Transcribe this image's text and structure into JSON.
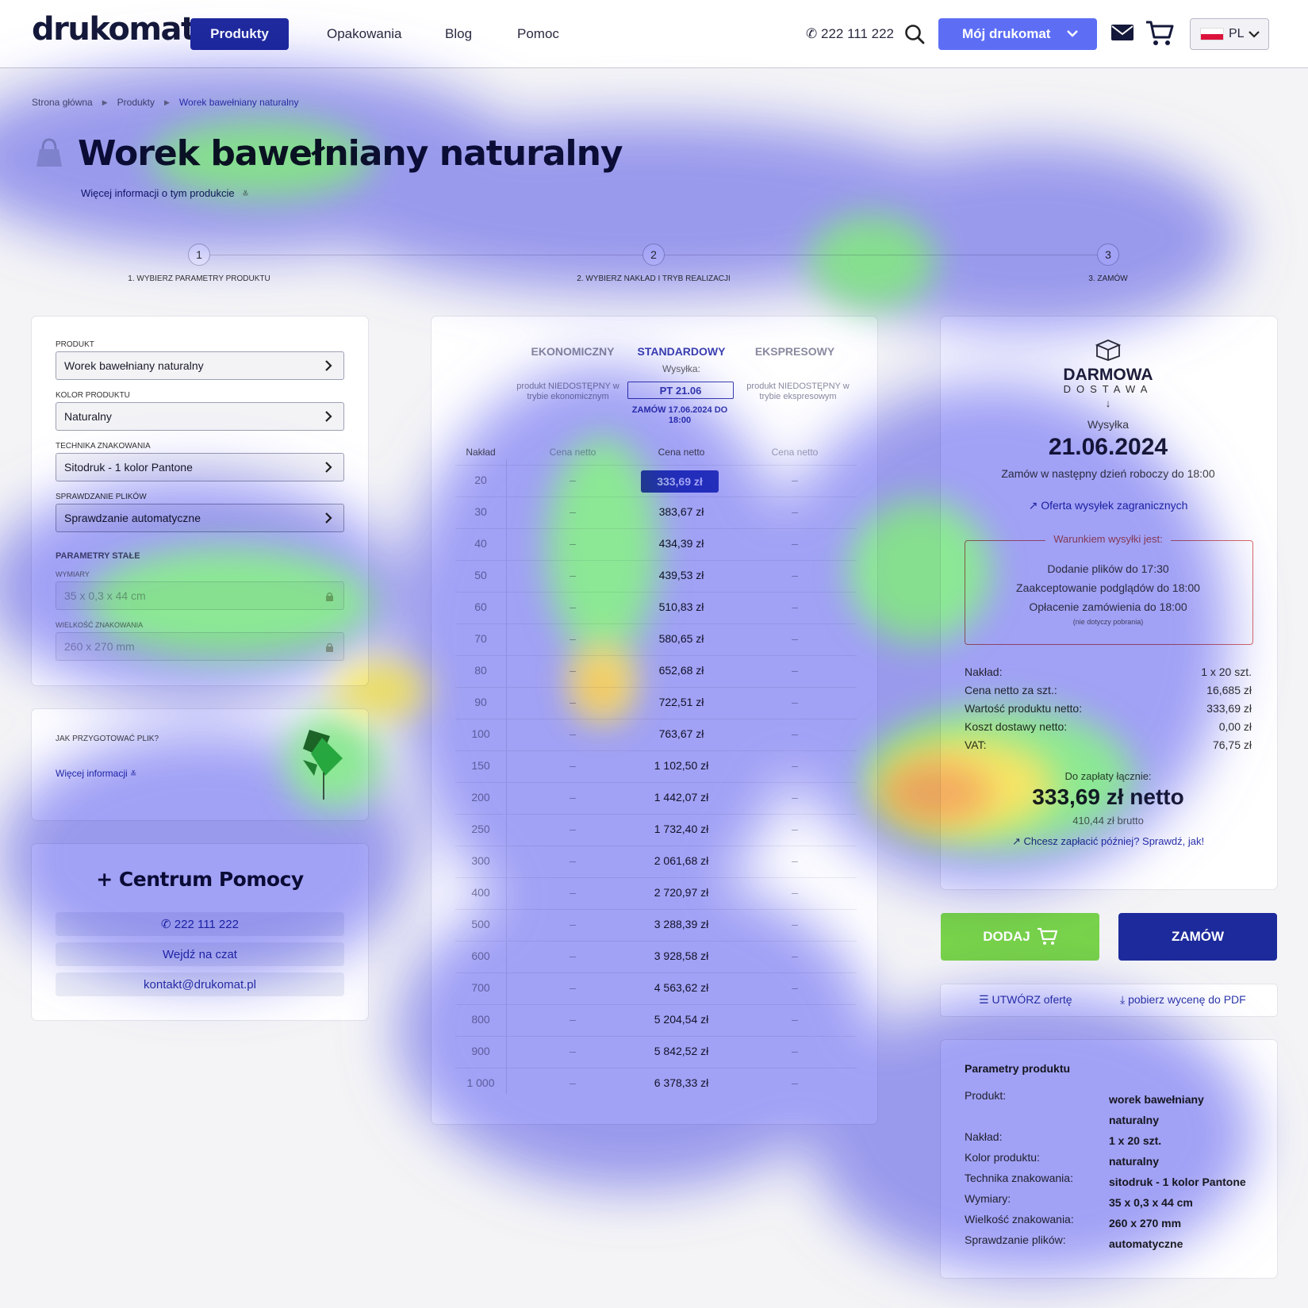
{
  "header": {
    "logo": "drukomat.",
    "nav": {
      "produkty": "Produkty",
      "opakowania": "Opakowania",
      "blog": "Blog",
      "pomoc": "Pomoc"
    },
    "phone": "222 111 222",
    "account_label": "Mój drukomat",
    "lang": "PL"
  },
  "breadcrumb": [
    "Strona główna",
    "Produkty",
    "Worek bawełniany naturalny"
  ],
  "title": "Worek bawełniany naturalny",
  "more_info": "Więcej informacji o tym produkcie",
  "steps": [
    "1. WYBIERZ PARAMETRY PRODUKTU",
    "2. WYBIERZ NAKŁAD I TRYB REALIZACJI",
    "3. ZAMÓW"
  ],
  "step_numbers": [
    "1",
    "2",
    "3"
  ],
  "config": {
    "product_label": "PRODUKT",
    "product_value": "Worek bawełniany naturalny",
    "color_label": "KOLOR PRODUKTU",
    "color_value": "Naturalny",
    "technique_label": "TECHNIKA ZNAKOWANIA",
    "technique_value": "Sitodruk - 1 kolor Pantone",
    "files_label": "SPRAWDZANIE PLIKÓW",
    "files_value": "Sprawdzanie automatyczne",
    "fixed_label": "PARAMETRY STAŁE",
    "dims_label": "WYMIARY",
    "dims_value": "35 x 0,3 x 44 cm",
    "mark_size_label": "WIELKOŚĆ ZNAKOWANIA",
    "mark_size_value": "260 x 270 mm"
  },
  "prep": {
    "question": "JAK PRZYGOTOWAĆ PLIK?",
    "link": "Więcej informacji"
  },
  "help": {
    "title": "+ Centrum Pomocy",
    "phone": "222 111 222",
    "chat": "Wejdź na czat",
    "email": "kontakt@drukomat.pl"
  },
  "pricing": {
    "modes": {
      "eco": "EKONOMICZNY",
      "std": "STANDARDOWY",
      "exp": "EKSPRESOWY"
    },
    "shipping_label": "Wysyłka:",
    "eco_na": "produkt NIEDOSTĘPNY w trybie ekonomicznym",
    "exp_na": "produkt NIEDOSTĘPNY w trybie ekspresowym",
    "ship_date": "PT 21.06",
    "order_by": "ZAMÓW 17.06.2024 DO 18:00",
    "col_qty": "Nakład",
    "col_price": "Cena netto",
    "dash": "–",
    "rows": [
      {
        "q": "20",
        "p": "333,69 zł"
      },
      {
        "q": "30",
        "p": "383,67 zł"
      },
      {
        "q": "40",
        "p": "434,39 zł"
      },
      {
        "q": "50",
        "p": "439,53 zł"
      },
      {
        "q": "60",
        "p": "510,83 zł"
      },
      {
        "q": "70",
        "p": "580,65 zł"
      },
      {
        "q": "80",
        "p": "652,68 zł"
      },
      {
        "q": "90",
        "p": "722,51 zł"
      },
      {
        "q": "100",
        "p": "763,67 zł"
      },
      {
        "q": "150",
        "p": "1 102,50 zł"
      },
      {
        "q": "200",
        "p": "1 442,07 zł"
      },
      {
        "q": "250",
        "p": "1 732,40 zł"
      },
      {
        "q": "300",
        "p": "2 061,68 zł"
      },
      {
        "q": "400",
        "p": "2 720,97 zł"
      },
      {
        "q": "500",
        "p": "3 288,39 zł"
      },
      {
        "q": "600",
        "p": "3 928,58 zł"
      },
      {
        "q": "700",
        "p": "4 563,62 zł"
      },
      {
        "q": "800",
        "p": "5 204,54 zł"
      },
      {
        "q": "900",
        "p": "5 842,52 zł"
      },
      {
        "q": "1 000",
        "p": "6 378,33 zł"
      }
    ]
  },
  "summary": {
    "free_delivery": "DARMOWA",
    "delivery": "DOSTAWA",
    "ship_label": "Wysyłka",
    "ship_date": "21.06.2024",
    "order_note": "Zamów w następny dzień roboczy do 18:00",
    "intl_link": "Oferta wysyłek zagranicznych",
    "condition_title": "Warunkiem wysyłki jest:",
    "cond1": "Dodanie plików do 17:30",
    "cond2": "Zaakceptowanie podglądów do 18:00",
    "cond3": "Opłacenie zamówienia do 18:00",
    "cond_note": "(nie dotyczy pobrania)",
    "rows": [
      {
        "k": "Nakład:",
        "v": "1 x 20 szt."
      },
      {
        "k": "Cena netto za szt.:",
        "v": "16,685 zł"
      },
      {
        "k": "Wartość produktu netto:",
        "v": "333,69 zł"
      },
      {
        "k": "Koszt dostawy netto:",
        "v": "0,00 zł"
      },
      {
        "k": "VAT:",
        "v": "76,75 zł"
      }
    ],
    "total_label": "Do zapłaty łącznie:",
    "total_net": "333,69 zł netto",
    "total_gross": "410,44 zł brutto",
    "pay_later": "Chcesz zapłacić później? Sprawdź, jak!"
  },
  "actions": {
    "add": "DODAJ",
    "order": "ZAMÓW",
    "create_offer": "UTWÓRZ ofertę",
    "pdf": "pobierz wycenę do PDF"
  },
  "params": {
    "title": "Parametry produktu",
    "rows": [
      {
        "k": "Produkt:",
        "v": "worek bawełniany naturalny"
      },
      {
        "k": "Nakład:",
        "v": "1 x 20 szt."
      },
      {
        "k": "Kolor produktu:",
        "v": "naturalny"
      },
      {
        "k": "Technika znakowania:",
        "v": "sitodruk - 1 kolor Pantone"
      },
      {
        "k": "Wymiary:",
        "v": "35 x 0,3 x 44 cm"
      },
      {
        "k": "Wielkość znakowania:",
        "v": "260 x 270 mm"
      },
      {
        "k": "Sprawdzanie plików:",
        "v": "automatyczne"
      }
    ]
  },
  "colors": {
    "brand_dark": "#1f2a9e",
    "accent": "#5d6ef5",
    "green": "#78d34a",
    "warning": "#d96a6a"
  }
}
